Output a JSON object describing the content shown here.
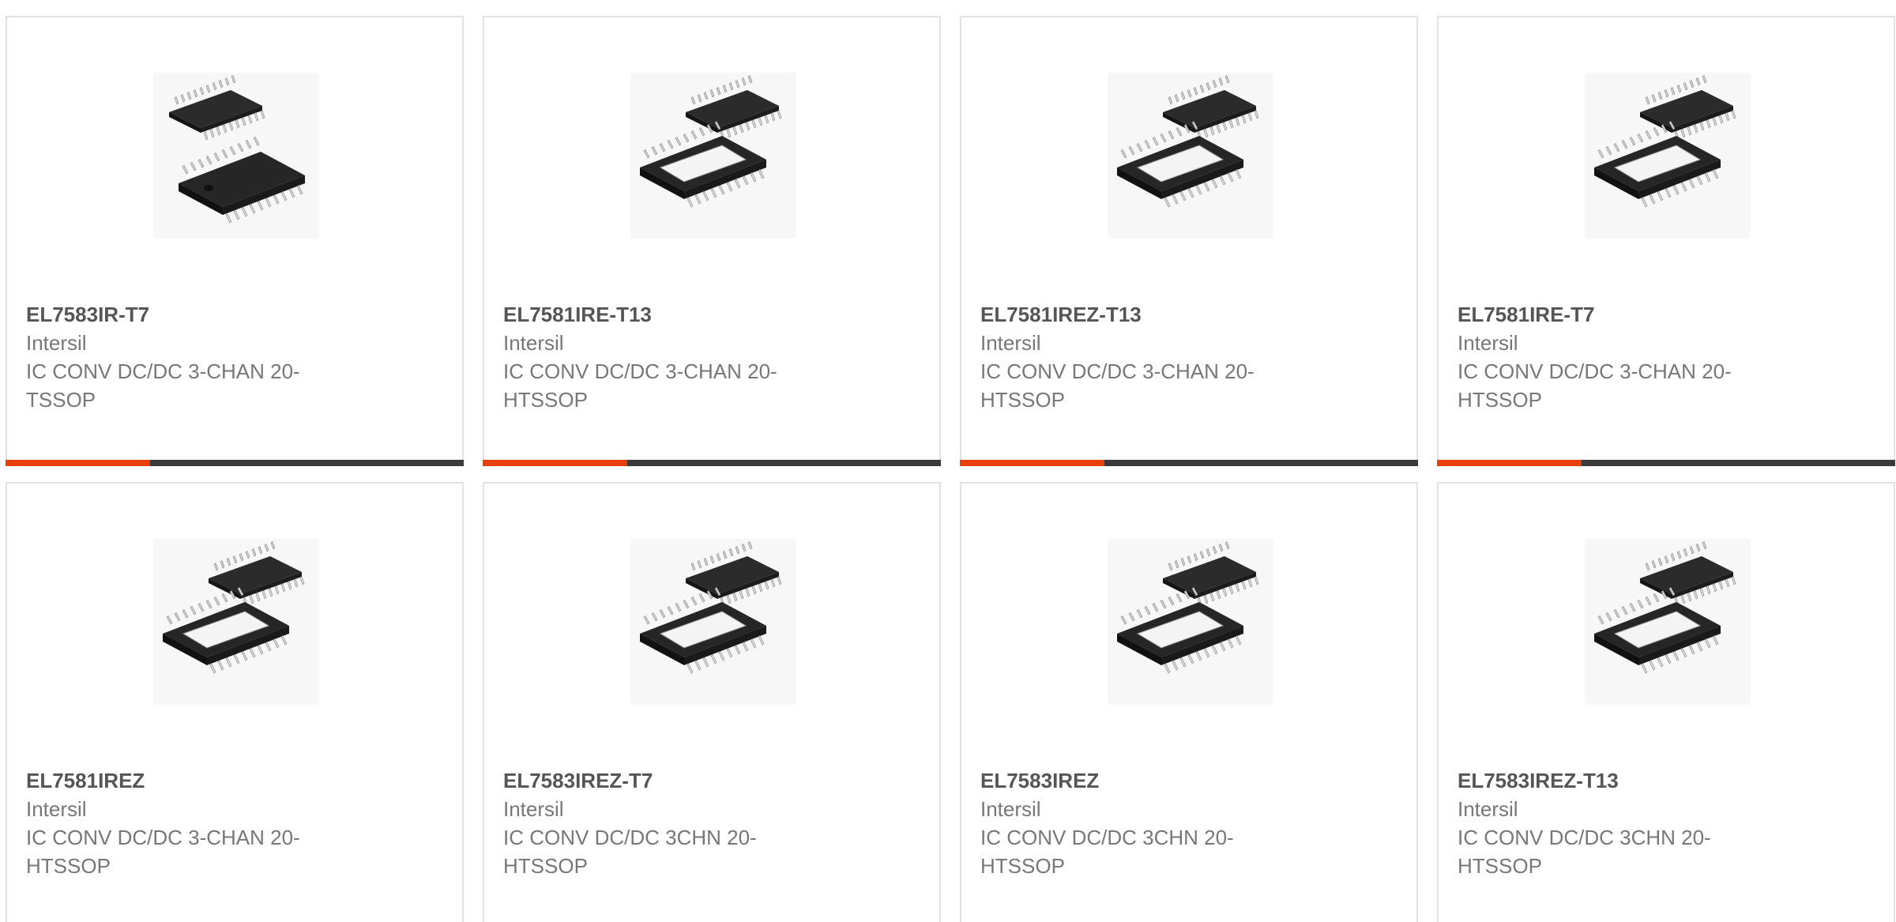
{
  "colors": {
    "accent": "#e8400c",
    "bar_dark": "#3a3a3a",
    "border": "#e2e2e2",
    "title_text": "#555555",
    "body_text": "#777777"
  },
  "products": [
    {
      "part_number": "EL7583IR-T7",
      "manufacturer": "Intersil",
      "description": "IC CONV DC/DC 3-CHAN 20-TSSOP",
      "image": "tssop-chip-image"
    },
    {
      "part_number": "EL7581IRE-T13",
      "manufacturer": "Intersil",
      "description": "IC CONV DC/DC 3-CHAN 20-HTSSOP",
      "image": "htssop-chip-image"
    },
    {
      "part_number": "EL7581IREZ-T13",
      "manufacturer": "Intersil",
      "description": "IC CONV DC/DC 3-CHAN 20-HTSSOP",
      "image": "htssop-chip-image"
    },
    {
      "part_number": "EL7581IRE-T7",
      "manufacturer": "Intersil",
      "description": "IC CONV DC/DC 3-CHAN 20-HTSSOP",
      "image": "htssop-chip-image"
    },
    {
      "part_number": "EL7581IREZ",
      "manufacturer": "Intersil",
      "description": "IC CONV DC/DC 3-CHAN 20-HTSSOP",
      "image": "htssop-chip-image"
    },
    {
      "part_number": "EL7583IREZ-T7",
      "manufacturer": "Intersil",
      "description": "IC CONV DC/DC 3CHN 20-HTSSOP",
      "image": "htssop-chip-image"
    },
    {
      "part_number": "EL7583IREZ",
      "manufacturer": "Intersil",
      "description": "IC CONV DC/DC 3CHN 20-HTSSOP",
      "image": "htssop-chip-image"
    },
    {
      "part_number": "EL7583IREZ-T13",
      "manufacturer": "Intersil",
      "description": "IC CONV DC/DC 3CHN 20-HTSSOP",
      "image": "htssop-chip-image"
    }
  ]
}
